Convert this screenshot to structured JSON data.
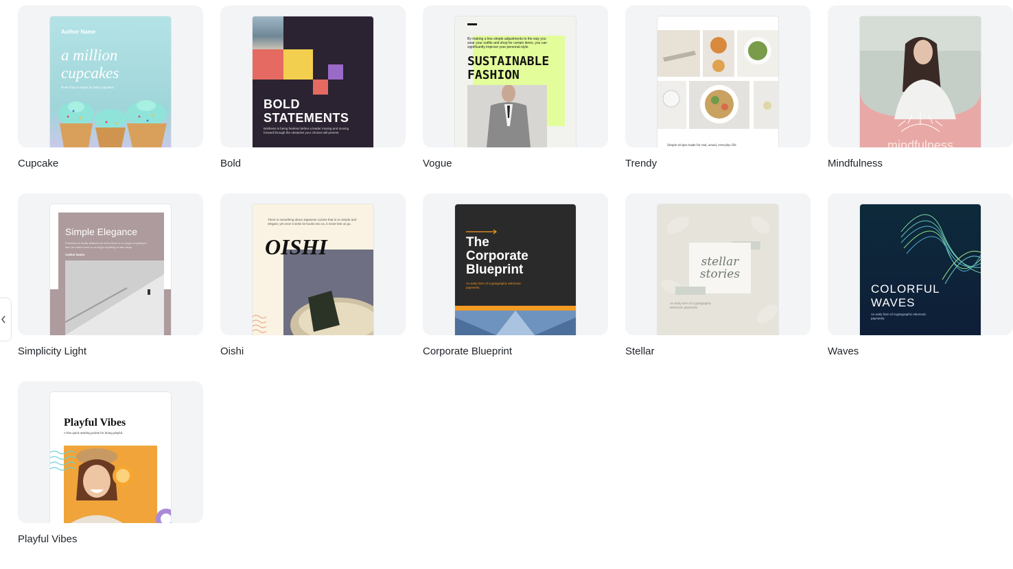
{
  "templates": [
    {
      "name": "Cupcake",
      "cover": {
        "author": "Author Name",
        "title_line1": "a million",
        "title_line2": "cupcakes",
        "subtitle": "Rose Tracy's recipe for tasty cupcakes"
      }
    },
    {
      "name": "Bold",
      "cover": {
        "title_line1": "BOLD",
        "title_line2": "STATEMENTS",
        "body": "Boldness is being fearless before a leader moving and moving forward through the obstacles your choices will present"
      }
    },
    {
      "name": "Vogue",
      "cover": {
        "intro": "By making a few simple adjustments to the way you wear your outfits and shop for certain items, you can significantly improve your personal style.",
        "title_line1": "SUSTAINABLE",
        "title_line2": "FASHION"
      }
    },
    {
      "name": "Trendy",
      "cover": {
        "caption": "Simple recipes made for real, actual, everyday life"
      }
    },
    {
      "name": "Mindfulness",
      "cover": {
        "title": "mindfulness"
      }
    },
    {
      "name": "Simplicity Light",
      "cover": {
        "title": "Simple Elegance",
        "body": "Perfection is finally attained not when there is no longer anything to add, but when there is no longer anything to take away.",
        "author": "Author Name"
      }
    },
    {
      "name": "Oishi",
      "cover": {
        "intro": "There is something about Japanese cuisine that is so simple and elegant, yet once it sinks its hooks into us, it never lets us go.",
        "title": "OISHI"
      }
    },
    {
      "name": "Corporate Blueprint",
      "cover": {
        "title_line1": "The",
        "title_line2": "Corporate",
        "title_line3": "Blueprint",
        "subtitle": "An early form of cryptographic electronic payments"
      }
    },
    {
      "name": "Stellar",
      "cover": {
        "title_line1": "stellar",
        "title_line2": "stories",
        "subtitle": "An early form of cryptographic electronic payments"
      }
    },
    {
      "name": "Waves",
      "cover": {
        "title_line1": "COLORFUL",
        "title_line2": "WAVES",
        "subtitle": "An early form of cryptographic electronic payments"
      }
    },
    {
      "name": "Playful Vibes",
      "cover": {
        "title": "Playful Vibes",
        "subtitle": "A few quick starting points for being playful."
      }
    }
  ],
  "colors": {
    "tile_bg": "#f3f4f6",
    "cupcake_bg": "#a9dde0",
    "bold_bg": "#2b2331",
    "vogue_accent": "#e3fd9a",
    "mindfulness_bg": "#e8a9a6",
    "simplicity_bg": "#ad9b9e",
    "oishi_bg": "#faf3e3",
    "corporate_bg": "#2a2a2a",
    "corporate_accent": "#f59a23",
    "stellar_bg": "#e6e3da",
    "waves_bg": "#0e1e38",
    "playful_accent": "#f0a43a"
  },
  "side_toggle": {
    "icon": "chevron-left-icon"
  }
}
